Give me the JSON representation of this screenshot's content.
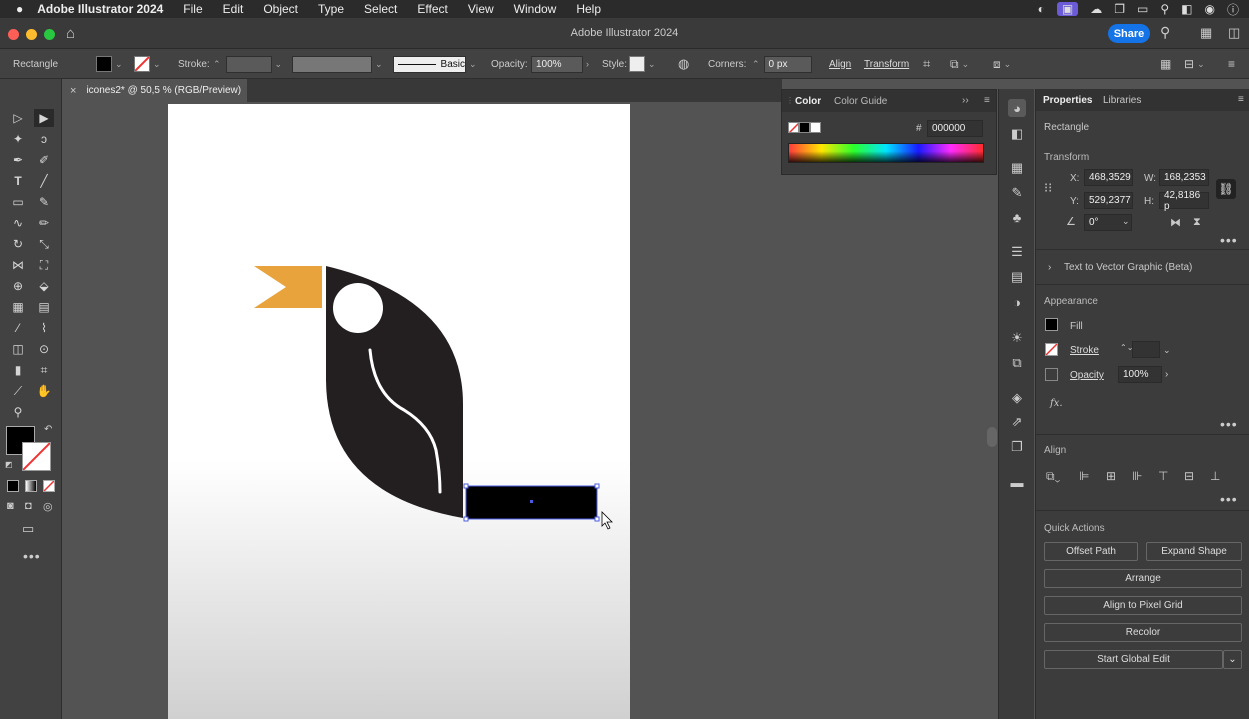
{
  "menubar": {
    "apple": "",
    "app": "Adobe Illustrator 2024",
    "items": [
      "File",
      "Edit",
      "Object",
      "Type",
      "Select",
      "Effect",
      "View",
      "Window",
      "Help"
    ]
  },
  "window": {
    "title": "Adobe Illustrator 2024",
    "share": "Share"
  },
  "control": {
    "object_type": "Rectangle",
    "stroke_label": "Stroke:",
    "brush": "Basic",
    "opacity_label": "Opacity:",
    "opacity_value": "100%",
    "style_label": "Style:",
    "corners_label": "Corners:",
    "corners_value": "0 px",
    "align": "Align",
    "transform": "Transform"
  },
  "doc": {
    "tab": "icones2* @ 50,5 % (RGB/Preview)",
    "close": "×"
  },
  "color_panel": {
    "tab1": "Color",
    "tab2": "Color Guide",
    "hash": "#",
    "hex": "000000"
  },
  "properties": {
    "tab1": "Properties",
    "tab2": "Libraries",
    "object": "Rectangle",
    "transform_title": "Transform",
    "x_label": "X:",
    "x": "468,3529",
    "y_label": "Y:",
    "y": "529,2377",
    "w_label": "W:",
    "w": "168,2353",
    "h_label": "H:",
    "h": "42,8186 p",
    "angle": "0°",
    "text_to_vector": "Text to Vector Graphic (Beta)",
    "appearance_title": "Appearance",
    "fill": "Fill",
    "stroke": "Stroke",
    "opacity": "Opacity",
    "opacity_value": "100%",
    "fx": "fx.",
    "align_title": "Align",
    "quick_actions": "Quick Actions",
    "offset_path": "Offset Path",
    "expand_shape": "Expand Shape",
    "arrange": "Arrange",
    "align_pixel": "Align to Pixel Grid",
    "recolor": "Recolor",
    "global_edit": "Start Global Edit"
  },
  "colors": {
    "accent": "#1473e6",
    "beak": "#e8a33c",
    "body": "#231f20",
    "selection": "#4a5be0"
  }
}
